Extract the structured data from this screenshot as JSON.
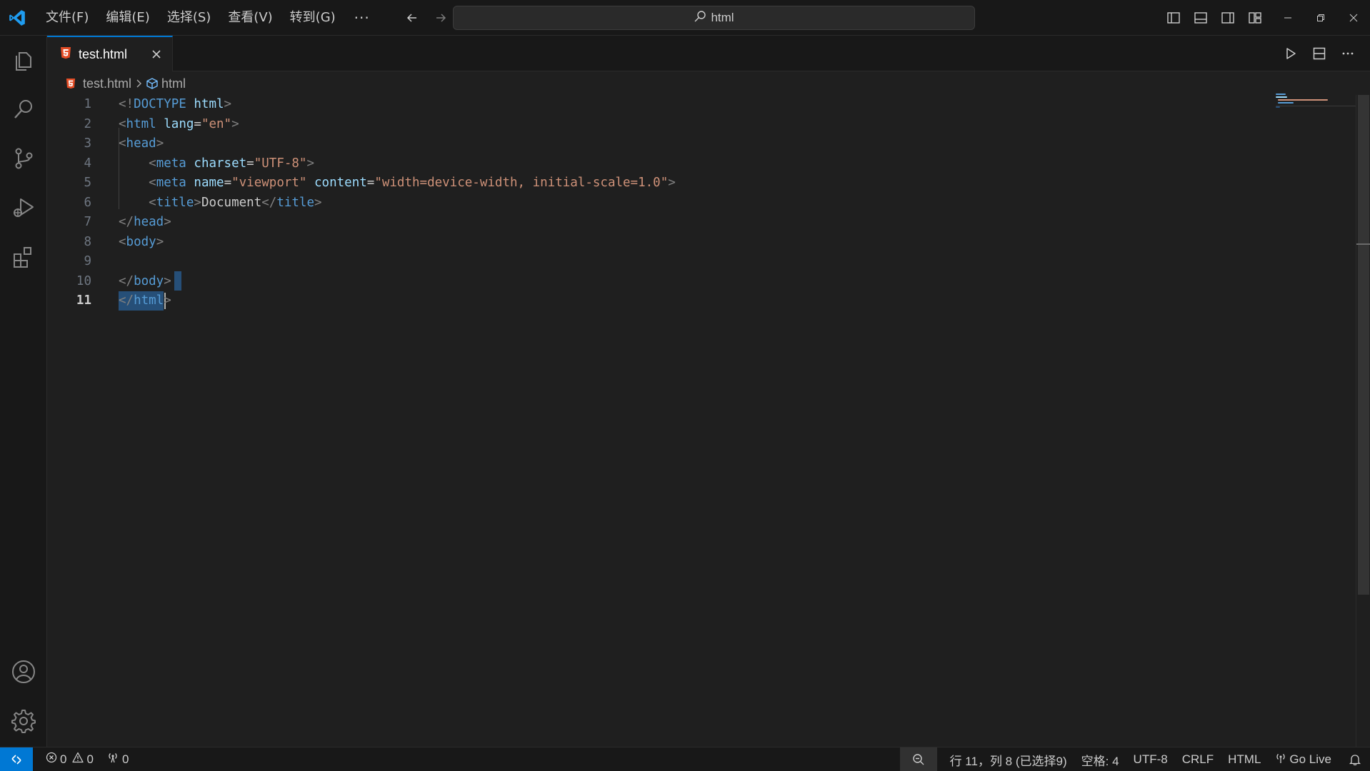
{
  "menu": {
    "file": "文件(F)",
    "edit": "编辑(E)",
    "select": "选择(S)",
    "view": "查看(V)",
    "goto": "转到(G)",
    "more": "···"
  },
  "search": {
    "label": "html"
  },
  "tabs": [
    {
      "label": "test.html",
      "active": true
    }
  ],
  "breadcrumb": {
    "file": "test.html",
    "symbol": "html"
  },
  "editor": {
    "active_line": 11,
    "lines": [
      {
        "n": "1",
        "tokens": [
          [
            "br",
            "<!"
          ],
          [
            "tag",
            "DOCTYPE"
          ],
          [
            "txt",
            " "
          ],
          [
            "attr",
            "html"
          ],
          [
            "br",
            ">"
          ]
        ]
      },
      {
        "n": "2",
        "tokens": [
          [
            "br",
            "<"
          ],
          [
            "tag",
            "html"
          ],
          [
            "txt",
            " "
          ],
          [
            "attr",
            "lang"
          ],
          [
            "txt",
            "="
          ],
          [
            "str",
            "\"en\""
          ],
          [
            "br",
            ">"
          ]
        ]
      },
      {
        "n": "3",
        "tokens": [
          [
            "br",
            "<"
          ],
          [
            "tag",
            "head"
          ],
          [
            "br",
            ">"
          ]
        ]
      },
      {
        "n": "4",
        "tokens": [
          [
            "txt",
            "    "
          ],
          [
            "br",
            "<"
          ],
          [
            "tag",
            "meta"
          ],
          [
            "txt",
            " "
          ],
          [
            "attr",
            "charset"
          ],
          [
            "txt",
            "="
          ],
          [
            "str",
            "\"UTF-8\""
          ],
          [
            "br",
            ">"
          ]
        ]
      },
      {
        "n": "5",
        "tokens": [
          [
            "txt",
            "    "
          ],
          [
            "br",
            "<"
          ],
          [
            "tag",
            "meta"
          ],
          [
            "txt",
            " "
          ],
          [
            "attr",
            "name"
          ],
          [
            "txt",
            "="
          ],
          [
            "str",
            "\"viewport\""
          ],
          [
            "txt",
            " "
          ],
          [
            "attr",
            "content"
          ],
          [
            "txt",
            "="
          ],
          [
            "str",
            "\"width=device-width, initial-scale=1.0\""
          ],
          [
            "br",
            ">"
          ]
        ]
      },
      {
        "n": "6",
        "tokens": [
          [
            "txt",
            "    "
          ],
          [
            "br",
            "<"
          ],
          [
            "tag",
            "title"
          ],
          [
            "br",
            ">"
          ],
          [
            "txt",
            "Document"
          ],
          [
            "br",
            "</"
          ],
          [
            "tag",
            "title"
          ],
          [
            "br",
            ">"
          ]
        ]
      },
      {
        "n": "7",
        "tokens": [
          [
            "br",
            "</"
          ],
          [
            "tag",
            "head"
          ],
          [
            "br",
            ">"
          ]
        ]
      },
      {
        "n": "8",
        "tokens": [
          [
            "br",
            "<"
          ],
          [
            "tag",
            "body"
          ],
          [
            "br",
            ">"
          ]
        ]
      },
      {
        "n": "9",
        "tokens": []
      },
      {
        "n": "10",
        "tokens": [
          [
            "br",
            "</"
          ],
          [
            "tag",
            "body"
          ],
          [
            "br",
            ">"
          ]
        ]
      },
      {
        "n": "11",
        "tokens": [
          [
            "br",
            "</"
          ],
          [
            "tag",
            "html"
          ],
          [
            "br",
            ">"
          ]
        ]
      }
    ]
  },
  "status": {
    "errors": "0",
    "warnings": "0",
    "ports": "0",
    "position": "行 11，列 8 (已选择9)",
    "spaces": "空格: 4",
    "encoding": "UTF-8",
    "eol": "CRLF",
    "language": "HTML",
    "golive": "Go Live"
  },
  "colors": {
    "accent": "#0078d4",
    "tag": "#569cd6",
    "attr": "#9cdcfe",
    "string": "#ce9178",
    "bracket": "#808080",
    "selection": "#264f78",
    "html_icon": "#e44d26"
  }
}
